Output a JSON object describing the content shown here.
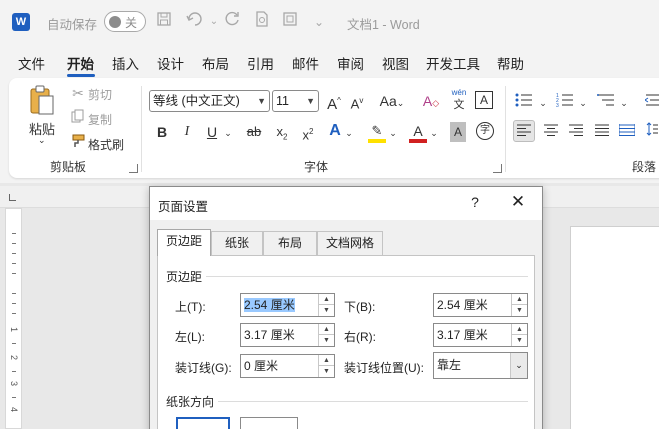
{
  "titlebar": {
    "app_icon": "W",
    "autosave_label": "自动保存",
    "autosave_state": "关",
    "doc_title": "文档1  -  Word",
    "quick_access": [
      "save-icon",
      "undo-icon",
      "redo-icon",
      "print-preview-icon",
      "template-icon",
      "more-icon"
    ]
  },
  "tabs": [
    {
      "label": "文件"
    },
    {
      "label": "开始"
    },
    {
      "label": "插入"
    },
    {
      "label": "设计"
    },
    {
      "label": "布局"
    },
    {
      "label": "引用"
    },
    {
      "label": "邮件"
    },
    {
      "label": "审阅"
    },
    {
      "label": "视图"
    },
    {
      "label": "开发工具"
    },
    {
      "label": "帮助"
    }
  ],
  "ribbon": {
    "clipboard": {
      "paste_label": "粘贴",
      "cut_label": "剪切",
      "copy_label": "复制",
      "format_painter_label": "格式刷",
      "group_label": "剪贴板"
    },
    "font": {
      "font_name": "等线 (中文正文)",
      "font_size": "11",
      "group_label": "字体",
      "pinyin_top": "wén",
      "pinyin_bottom": "文",
      "border_char": "A",
      "grow": "A",
      "shrink": "A",
      "case": "Aa",
      "bold": "B",
      "italic": "I",
      "underline": "U",
      "strike": "ab",
      "subscript": "x",
      "superscript": "x",
      "effects": "A",
      "highlight": "ab",
      "font_color": "A",
      "shading": "A",
      "enclose": "字"
    },
    "paragraph": {
      "group_label": "段落"
    }
  },
  "vruler": [
    "1",
    "2",
    "3",
    "4"
  ],
  "dialog": {
    "title": "页面设置",
    "help": "?",
    "close": "✕",
    "tabs": [
      "页边距",
      "纸张",
      "布局",
      "文档网格"
    ],
    "margins_section": "页边距",
    "top_label": "上(T):",
    "top_value": "2.54 厘米",
    "bottom_label": "下(B):",
    "bottom_value": "2.54 厘米",
    "left_label": "左(L):",
    "left_value": "3.17 厘米",
    "right_label": "右(R):",
    "right_value": "3.17 厘米",
    "gutter_label": "装订线(G):",
    "gutter_value": "0 厘米",
    "gutter_pos_label": "装订线位置(U):",
    "gutter_pos_value": "靠左",
    "orientation_section": "纸张方向"
  }
}
